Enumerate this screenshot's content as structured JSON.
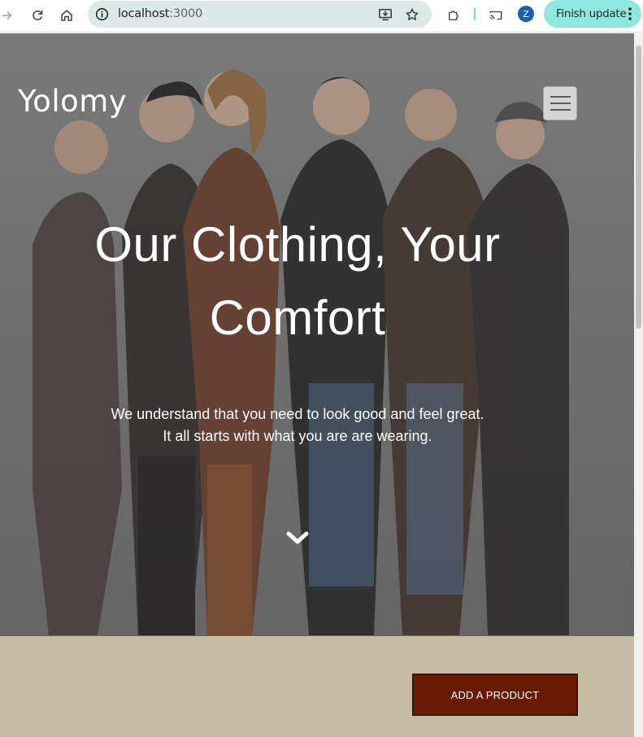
{
  "browser": {
    "url_host": "localhost",
    "url_port": ":3000",
    "profile_initial": "Z",
    "finish_update_label": "Finish update",
    "icons": {
      "forward": "forward-arrow-icon",
      "reload": "reload-icon",
      "home": "home-icon",
      "site_info": "info-icon",
      "install": "install-app-icon",
      "bookmark": "star-icon",
      "extensions": "puzzle-icon",
      "cast": "cast-icon",
      "menu": "kebab-menu-icon"
    },
    "colors": {
      "omnibox_bg": "#dde9e6",
      "finish_update_bg": "#8ee8df",
      "profile_bg": "#1a5fa8"
    }
  },
  "site": {
    "brand": "Yolomy",
    "menu_icon": "hamburger-icon"
  },
  "hero": {
    "headline": "Our Clothing, Your Comfort",
    "subtext_line1": "We understand that you need to look good and feel great.",
    "subtext_line2": "It all starts with what you are are wearing.",
    "scroll_icon": "chevron-down-icon"
  },
  "actions": {
    "add_product_label": "ADD A PRODUCT"
  },
  "colors": {
    "band_bg": "#c6bca4",
    "button_bg": "#6a1a03",
    "button_border": "#2c1a12"
  }
}
